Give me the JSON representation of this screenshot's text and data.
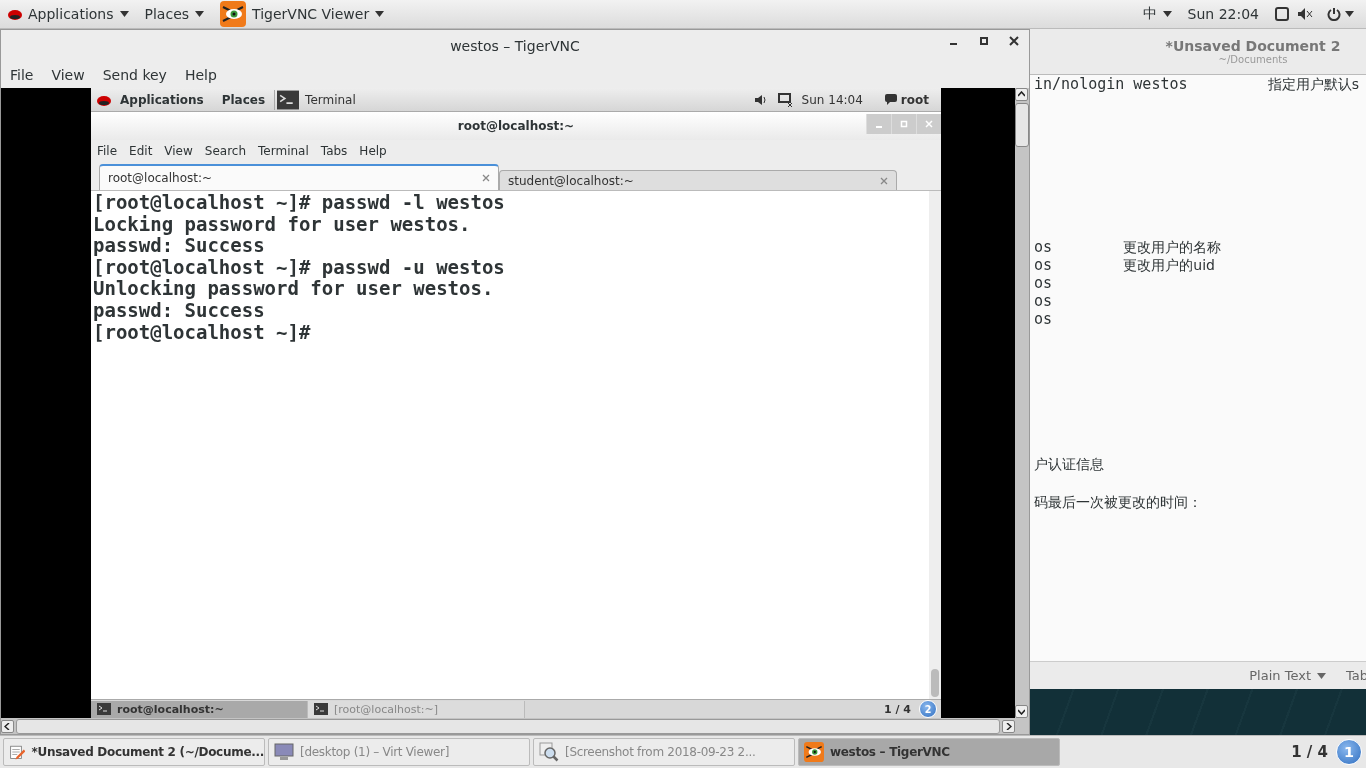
{
  "top_bar": {
    "menus": [
      {
        "label": "Applications"
      },
      {
        "label": "Places"
      }
    ],
    "app": {
      "label": "TigerVNC Viewer"
    },
    "input_method": "中",
    "clock": "Sun 22:04"
  },
  "vnc_window": {
    "title": "westos – TigerVNC",
    "menu": [
      "File",
      "View",
      "Send key",
      "Help"
    ],
    "remote": {
      "panel": {
        "menus": [
          "Applications",
          "Places"
        ],
        "app": "Terminal",
        "clock": "Sun 14:04",
        "user": "root"
      },
      "terminal": {
        "title": "root@localhost:~",
        "menu": [
          "File",
          "Edit",
          "View",
          "Search",
          "Terminal",
          "Tabs",
          "Help"
        ],
        "tabs": [
          {
            "label": "root@localhost:~",
            "selected": true
          },
          {
            "label": "student@localhost:~",
            "selected": false
          }
        ],
        "lines": [
          "[root@localhost ~]# passwd -l westos",
          "Locking password for user westos.",
          "passwd: Success",
          "[root@localhost ~]# passwd -u westos",
          "Unlocking password for user westos.",
          "passwd: Success",
          "[root@localhost ~]#"
        ]
      },
      "taskbar": {
        "items": [
          {
            "label": "root@localhost:~",
            "selected": true
          },
          {
            "label": "[root@localhost:~]",
            "selected": false
          }
        ],
        "pager": "1 / 4",
        "badge": "2"
      }
    }
  },
  "editor": {
    "title": "*Unsaved Document 2",
    "subtitle": "~/Documents",
    "blocks": [
      [
        {
          "code": "in/nologin westos",
          "note": "指定用户默认s"
        }
      ],
      [
        {
          "code": "os",
          "note": "更改用户的名称"
        },
        {
          "code": "os",
          "note": "更改用户的uid"
        },
        {
          "code": "os"
        },
        {
          "code": "os"
        },
        {
          "code": "os"
        }
      ],
      [
        {
          "note": "户认证信息"
        }
      ],
      [
        {
          "note": "码最后一次被更改的时间："
        }
      ]
    ],
    "status": {
      "language": "Plain Text",
      "tab": "Tab"
    }
  },
  "taskbar": {
    "items": [
      {
        "label": "*Unsaved Document 2 (~/Docume...",
        "kind": "editor",
        "selected": false
      },
      {
        "label": "[desktop (1) – Virt Viewer]",
        "kind": "monitor",
        "selected": false
      },
      {
        "label": "[Screenshot from 2018-09-23 2...",
        "kind": "viewer",
        "selected": false
      },
      {
        "label": "westos – TigerVNC",
        "kind": "vnc",
        "selected": true
      }
    ],
    "pager": "1 / 4",
    "badge": "1"
  }
}
